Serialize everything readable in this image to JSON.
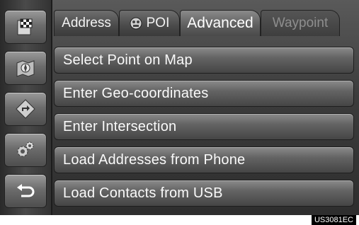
{
  "tabs": [
    {
      "label": "Address",
      "state": "normal",
      "icon": null
    },
    {
      "label": "POI",
      "state": "normal",
      "icon": "poi-icon"
    },
    {
      "label": "Advanced",
      "state": "active",
      "icon": null
    },
    {
      "label": "Waypoint",
      "state": "disabled",
      "icon": null
    }
  ],
  "menu": {
    "items": [
      {
        "label": "Select Point on Map"
      },
      {
        "label": "Enter Geo-coordinates"
      },
      {
        "label": "Enter Intersection"
      },
      {
        "label": "Load Addresses from Phone"
      },
      {
        "label": "Load Contacts from USB"
      }
    ]
  },
  "sidebar": {
    "buttons": [
      {
        "icon": "destination-flag-icon"
      },
      {
        "icon": "map-compass-icon"
      },
      {
        "icon": "route-direction-icon"
      },
      {
        "icon": "settings-gear-icon"
      },
      {
        "icon": "back-arrow-icon"
      }
    ]
  },
  "caption": "US3081EC"
}
